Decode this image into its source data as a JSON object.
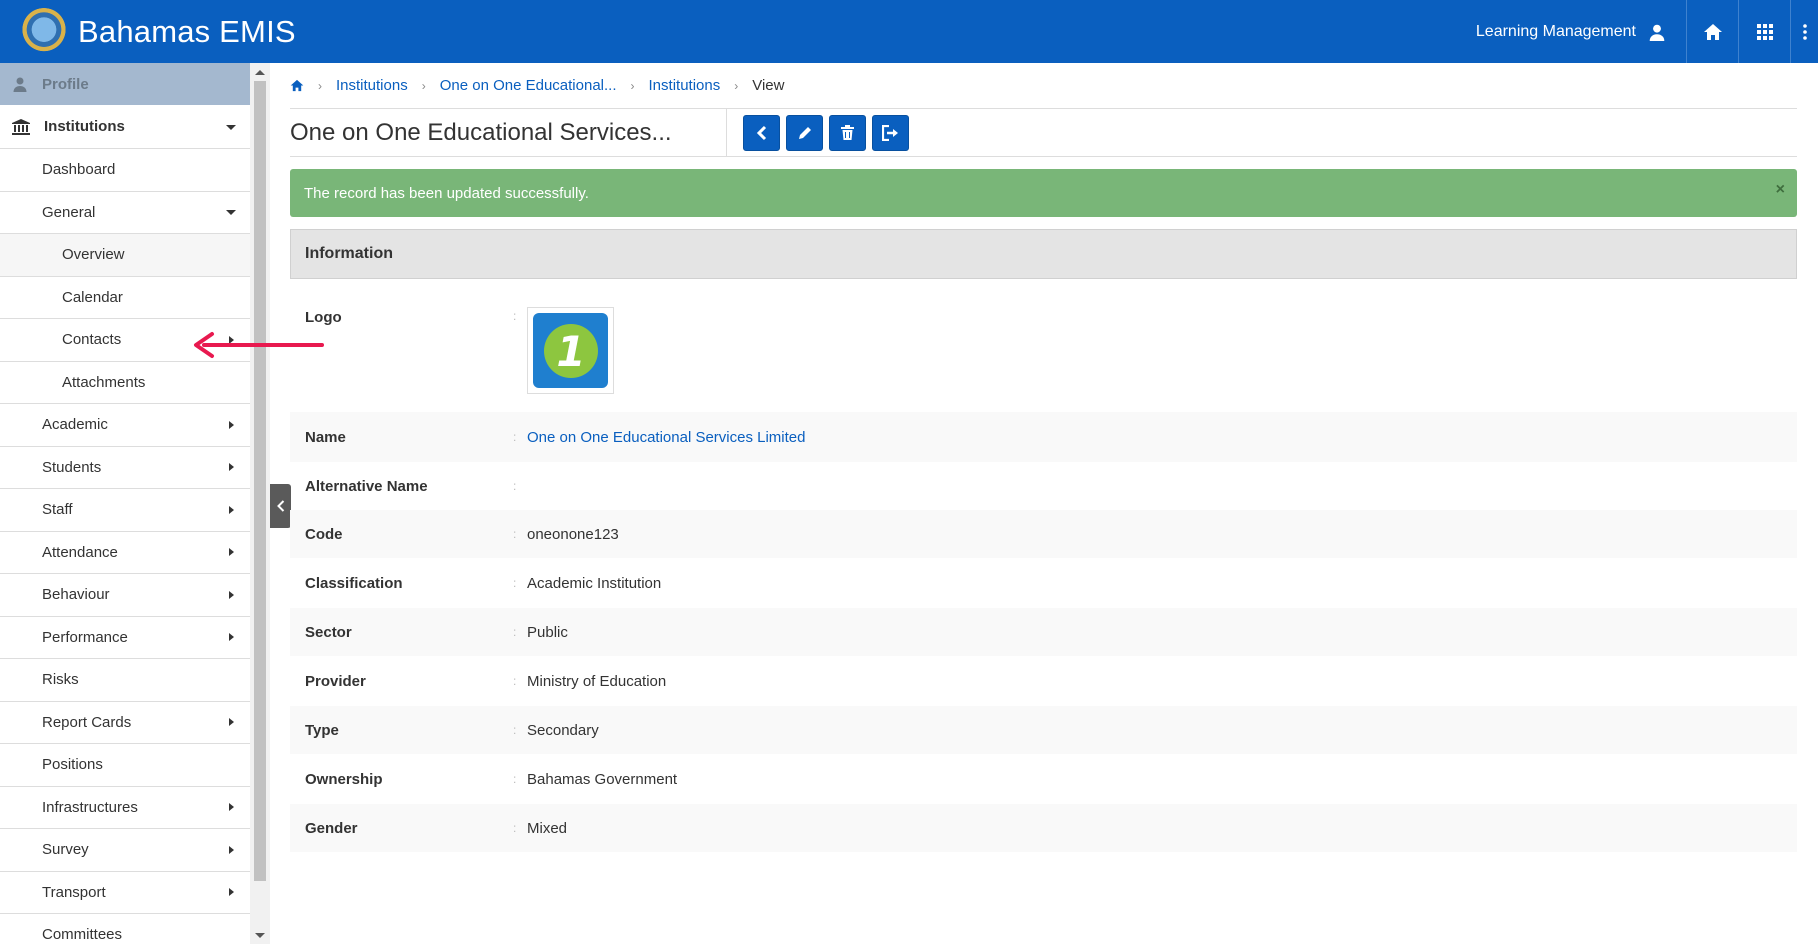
{
  "header": {
    "app_title": "Bahamas EMIS",
    "user_label": "Learning Management",
    "icons": [
      "user-icon",
      "home-icon",
      "apps-grid-icon",
      "more-vert-icon"
    ]
  },
  "sidebar": {
    "profile_label": "Profile",
    "section_label": "Institutions",
    "items": [
      {
        "label": "Dashboard"
      },
      {
        "label": "General"
      },
      {
        "label": "Overview"
      },
      {
        "label": "Calendar"
      },
      {
        "label": "Contacts"
      },
      {
        "label": "Attachments"
      },
      {
        "label": "Academic"
      },
      {
        "label": "Students"
      },
      {
        "label": "Staff"
      },
      {
        "label": "Attendance"
      },
      {
        "label": "Behaviour"
      },
      {
        "label": "Performance"
      },
      {
        "label": "Risks"
      },
      {
        "label": "Report Cards"
      },
      {
        "label": "Positions"
      },
      {
        "label": "Infrastructures"
      },
      {
        "label": "Survey"
      },
      {
        "label": "Transport"
      },
      {
        "label": "Committees"
      }
    ]
  },
  "breadcrumb": {
    "items": [
      "Institutions",
      "One on One Educational...",
      "Institutions"
    ],
    "current": "View"
  },
  "page": {
    "title": "One on One Educational Services...",
    "tool_icons": [
      "back-icon",
      "edit-icon",
      "delete-icon",
      "export-icon"
    ]
  },
  "alert": {
    "message": "The record has been updated successfully.",
    "close": "×"
  },
  "info": {
    "header": "Information",
    "logo_label": "Logo",
    "logo_digit": "1",
    "fields": [
      {
        "label": "Name",
        "value": "One on One Educational Services Limited"
      },
      {
        "label": "Alternative Name",
        "value": ""
      },
      {
        "label": "Code",
        "value": "oneonone123"
      },
      {
        "label": "Classification",
        "value": "Academic Institution"
      },
      {
        "label": "Sector",
        "value": "Public"
      },
      {
        "label": "Provider",
        "value": "Ministry of Education"
      },
      {
        "label": "Type",
        "value": "Secondary"
      },
      {
        "label": "Ownership",
        "value": "Bahamas Government"
      },
      {
        "label": "Gender",
        "value": "Mixed"
      }
    ]
  },
  "colors": {
    "primary": "#0a5fbf",
    "success": "#79b678",
    "annotation": "#e8194f"
  }
}
